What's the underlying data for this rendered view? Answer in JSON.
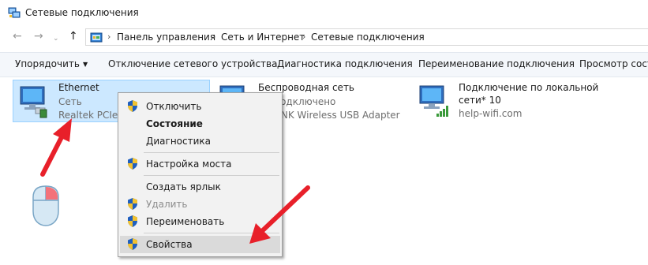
{
  "window": {
    "title": "Сетевые подключения",
    "icon": "network-connections-icon"
  },
  "nav": {
    "back_icon": "arrow-left-icon",
    "forward_icon": "arrow-right-icon",
    "recent_icon": "chevron-down-icon",
    "up_icon": "arrow-up-icon",
    "breadcrumb": [
      "Панель управления",
      "Сеть и Интернет",
      "Сетевые подключения"
    ]
  },
  "toolbar": {
    "organize": "Упорядочить",
    "disable_device": "Отключение сетевого устройства",
    "diagnose": "Диагностика подключения",
    "rename": "Переименование подключения",
    "view_status": "Просмотр состо"
  },
  "connections": [
    {
      "name": "Ethernet",
      "status": "Сеть",
      "device": "Realtek PCIe G",
      "icon": "ethernet-adapter-icon",
      "selected": true
    },
    {
      "name": "Беспроводная сеть",
      "status": "Не подключено",
      "device": "TP-LINK Wireless USB Adapter",
      "icon": "wireless-adapter-icon",
      "selected": false
    },
    {
      "name": "Подключение по локальной",
      "name_line2": "сети* 10",
      "status": "help-wifi.com",
      "icon": "wifi-signal-icon",
      "selected": false
    }
  ],
  "context_menu": {
    "items": [
      {
        "label": "Отключить",
        "icon": "uac-shield-icon",
        "bold": false,
        "disabled": false
      },
      {
        "label": "Состояние",
        "icon": "",
        "bold": true,
        "disabled": false
      },
      {
        "label": "Диагностика",
        "icon": "",
        "bold": false,
        "disabled": false
      },
      {
        "label": "Настройка моста",
        "icon": "uac-shield-icon",
        "bold": false,
        "disabled": false
      },
      {
        "label": "Создать ярлык",
        "icon": "",
        "bold": false,
        "disabled": false
      },
      {
        "label": "Удалить",
        "icon": "uac-shield-icon",
        "bold": false,
        "disabled": true
      },
      {
        "label": "Переименовать",
        "icon": "uac-shield-icon",
        "bold": false,
        "disabled": false
      },
      {
        "label": "Свойства",
        "icon": "uac-shield-icon",
        "bold": false,
        "disabled": false,
        "highlighted": true
      }
    ]
  },
  "annotations": {
    "arrow_color": "#e8202a",
    "mouse_icon": "mouse-right-click-icon",
    "accent_selection": "#cce8ff"
  }
}
